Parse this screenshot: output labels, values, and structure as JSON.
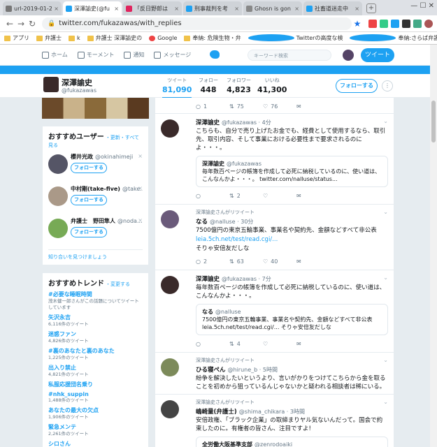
{
  "browser": {
    "tabs": [
      {
        "title": "url-2019-01-2",
        "color": "#777",
        "active": false
      },
      {
        "title": "深澤諭史(@fu",
        "color": "#1da1f2",
        "active": true
      },
      {
        "title": "「反日野郎は",
        "color": "#e0245e",
        "active": false
      },
      {
        "title": "刑事裁判を考",
        "color": "#1da1f2",
        "active": false
      },
      {
        "title": "Ghosn is gon",
        "color": "#888",
        "active": false
      },
      {
        "title": "社畜道迷走中",
        "color": "#1da1f2",
        "active": false
      }
    ],
    "url": "twitter.com/fukazawas/with_replies",
    "bookmarks": [
      {
        "label": "アプリ",
        "kind": "apps"
      },
      {
        "label": "弁護士",
        "kind": "folder"
      },
      {
        "label": "k",
        "kind": "folder"
      },
      {
        "label": "弁護士 深澤諭史の",
        "kind": "folder"
      },
      {
        "label": "Google",
        "kind": "g"
      },
      {
        "label": "奉納: 危険生物・弁",
        "kind": "folder"
      },
      {
        "label": "Twitterの高度な検",
        "kind": "tw"
      },
      {
        "label": "奉納:さらば弁護士",
        "kind": "tw"
      }
    ]
  },
  "nav": {
    "home": "ホーム",
    "moments": "モーメント",
    "notifications": "通知",
    "messages": "メッセージ",
    "search_placeholder": "キーワード検索",
    "tweet_button": "ツイート"
  },
  "profile": {
    "name": "深澤諭史",
    "handle": "@fukazawas",
    "stats": [
      {
        "label": "ツイート",
        "value": "81,090",
        "active": true
      },
      {
        "label": "フォロー",
        "value": "448",
        "active": false
      },
      {
        "label": "フォロワー",
        "value": "4,823",
        "active": false
      },
      {
        "label": "いいね",
        "value": "41,300",
        "active": false
      }
    ],
    "follow_button": "フォローする"
  },
  "suggestions": {
    "title": "おすすめユーザー",
    "links": "・更新・すべて見る",
    "follow": "フォローする",
    "users": [
      {
        "name": "櫻井光政",
        "handle": "@okinahimeji",
        "color": "#556"
      },
      {
        "name": "中村剛(take-five)",
        "handle": "@take...",
        "color": "#a98"
      },
      {
        "name": "弁護士　野田隼人",
        "handle": "@noda...",
        "color": "#7a5"
      }
    ],
    "find_friends": "知り合いを見つけましょう"
  },
  "trends": {
    "title": "おすすめトレンド",
    "change": "・変更する",
    "items": [
      {
        "name": "#必要な睡眠時間",
        "desc": "茂木健一郎さんがこの話題についてツイートしています"
      },
      {
        "name": "矢沢永吉",
        "desc": "6,116件のツイート"
      },
      {
        "name": "迷惑ファン",
        "desc": "4,826件のツイート"
      },
      {
        "name": "#裏のあなたと裏のあなた",
        "desc": "1,225件のツイート"
      },
      {
        "name": "出入り禁止",
        "desc": "4,821件のツイート"
      },
      {
        "name": "私服応援団名乗り",
        "desc": ""
      },
      {
        "name": "#nhk_suppin",
        "desc": "1,488件のツイート"
      },
      {
        "name": "あなたの最大の欠点",
        "desc": "1,906件のツイート"
      },
      {
        "name": "緊急メンテ",
        "desc": "2,261件のツイート"
      },
      {
        "name": "シロさん",
        "desc": "7,051件のツイート"
      }
    ]
  },
  "timeline": {
    "top_actions": {
      "reply": "1",
      "retweet": "75",
      "like": "76"
    },
    "tweets": [
      {
        "retweet_label": "",
        "name": "深澤諭史",
        "handle": "@fukazawas",
        "time": "4分",
        "text": "こちらも、自分で売り上げたお金でも、経費として使用するなら、取引先、取引内容、そして事業における必要性まで要求されるのによ・・・。",
        "quote": {
          "name": "深澤諭史",
          "handle": "@fukazawas",
          "text": "毎年数百ページの帳簿を作成して必死に納税しているのに、使い道は、こんなんかよ・・・。 twitter.com/nalluse/status..."
        },
        "reply": "",
        "retweet": "2",
        "like": "",
        "avatar": "#3a2a2a"
      },
      {
        "retweet_label": "深澤諭史さんがリツイート",
        "name": "なる",
        "handle": "@nalluse",
        "time": "30分",
        "text": "7500億円の東京五輪事業、事業名や契約先、金額などすべて非公表",
        "link": "leia.5ch.net/test/read.cgi/...",
        "extra": "そりゃ安倍友だしな",
        "reply": "2",
        "retweet": "63",
        "like": "40",
        "avatar": "#6a5a7a"
      },
      {
        "retweet_label": "",
        "name": "深澤諭史",
        "handle": "@fukazawas",
        "time": "7分",
        "text": "毎年数百ページの帳簿を作成して必死に納税しているのに、使い道は、こんなんかよ・・・。",
        "quote": {
          "name": "なる",
          "handle": "@nalluse",
          "text": "7500億円の東京五輪事業、事業名や契約先、金額などすべて非公表 leia.5ch.net/test/read.cgi/... そりゃ安倍友だしな"
        },
        "reply": "",
        "retweet": "4",
        "like": "",
        "avatar": "#3a2a2a"
      },
      {
        "retweet_label": "深澤諭史さんがリツイート",
        "name": "ひる寝ぺん",
        "handle": "@hirune_b",
        "time": "5時間",
        "text": "紛争を解決したいというより、言いがかりをつけてこちらから金を取ることを初めから狙っているんじゃないかと疑われる相談者は稀にいる。",
        "reply": "",
        "retweet": "",
        "like": "",
        "avatar": "#7c8a5a"
      },
      {
        "retweet_label": "深澤諭史さんがリツイート",
        "name": "嶋崎量(弁護士)",
        "handle": "@shima_chikara",
        "time": "3時間",
        "text": "安倍政権、「ブラック企業」の取締まりヤル気ないんだって。国会で約束したのに。有権者の皆さん、注目ですよ!",
        "quote": {
          "name": "全労働大阪基準支部",
          "handle": "@zenrodoaiki",
          "text": ""
        },
        "reply": "",
        "retweet": "",
        "like": "",
        "avatar": "#444"
      }
    ]
  }
}
